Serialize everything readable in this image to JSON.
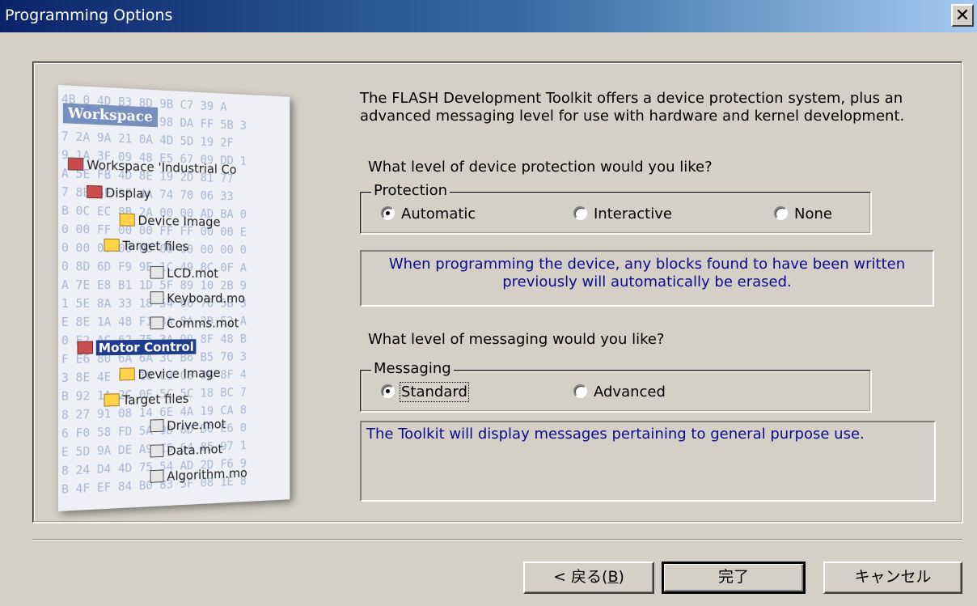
{
  "window": {
    "title": "Programming Options",
    "close_symbol": "✕"
  },
  "illustration": {
    "workspace_label": "Workspace",
    "hex_rows": [
      "4B 0 4D B3 8D 9B C7 39 A",
      "1 4B 3A 4B B1 98 DA FF 5B 3",
      "7 2A 9A 21 0A 4D 5D 19 2F",
      "9 1A 3F 09 48 E5 67 09 DD 1",
      "A 5E FB 4D 8E 19 2D 81 77",
      "7 8E 6F 9F 4A 74 70 06 33",
      "B 0C EC 8B 2A 00 00 AD BA 0",
      "0 00 FF 00 00 FF FF 00 00 E",
      "0 00 00 00 00 00 00 00 00 0",
      "0 8D 6D F9 9E 1C 49 8C 0F A",
      "A 7E E8 B1 1D 5F 89 10 2B 9",
      "1 5E 8A 33 18 54 66 76 5B 3",
      "E 8E 1A 48 F1 3A 8A 2D E2 A",
      "0 E2 AC 62 75 3A 99 8F 48 B",
      "F E6 80 6A 6A 3C B6 B5 70 3",
      "3 8E 4E 06 10 C3 CE 3B 8F 4",
      "B 92 1A 2C 0E 5C 5C 18 BC 7",
      "8 27 91 08 14 6E 4A 19 CA 8",
      "6 F0 58 FD 5A 9D 6D D0 E6 0",
      "E 5D 9A DE A9 C5 64 85 97 1",
      "8 24 D4 4D 75 54 AD 2D F6 9",
      "B 4F EF 84 B0 83 5F 08 1E 8"
    ],
    "tree": [
      {
        "label": "Workspace 'Industrial Co",
        "kind": "ws"
      },
      {
        "label": "Display",
        "kind": "proj"
      },
      {
        "label": "Device Image",
        "kind": "folder"
      },
      {
        "label": "Target files",
        "kind": "folder"
      },
      {
        "label": "LCD.mot",
        "kind": "file"
      },
      {
        "label": "Keyboard.mo",
        "kind": "file"
      },
      {
        "label": "Comms.mot",
        "kind": "file"
      },
      {
        "label": "Motor Control",
        "kind": "proj"
      },
      {
        "label": "Device Image",
        "kind": "folder"
      },
      {
        "label": "Target files",
        "kind": "folder"
      },
      {
        "label": "Drive.mot",
        "kind": "file"
      },
      {
        "label": "Data.mot",
        "kind": "file"
      },
      {
        "label": "Algorithm.mo",
        "kind": "file"
      }
    ]
  },
  "intro_text": "The FLASH Development Toolkit offers a device protection system, plus an advanced messaging level for use with hardware and kernel development.",
  "protection": {
    "question": "What level of device protection would you like?",
    "group_label": "Protection",
    "options": [
      "Automatic",
      "Interactive",
      "None"
    ],
    "selected": "Automatic",
    "description": "When programming the device, any blocks found to have been written previously will automatically be erased."
  },
  "messaging": {
    "question": "What level of messaging would you like?",
    "group_label": "Messaging",
    "options": [
      "Standard",
      "Advanced"
    ],
    "selected": "Standard",
    "description": "The Toolkit will display messages pertaining to general purpose use."
  },
  "buttons": {
    "back_prefix": "< 戻る(",
    "back_mnemonic": "B",
    "back_suffix": ")",
    "finish": "完了",
    "cancel": "キャンセル"
  },
  "icons": {
    "close": "close-icon",
    "radio_selected": "radio-selected-icon",
    "radio_unselected": "radio-unselected-icon"
  }
}
